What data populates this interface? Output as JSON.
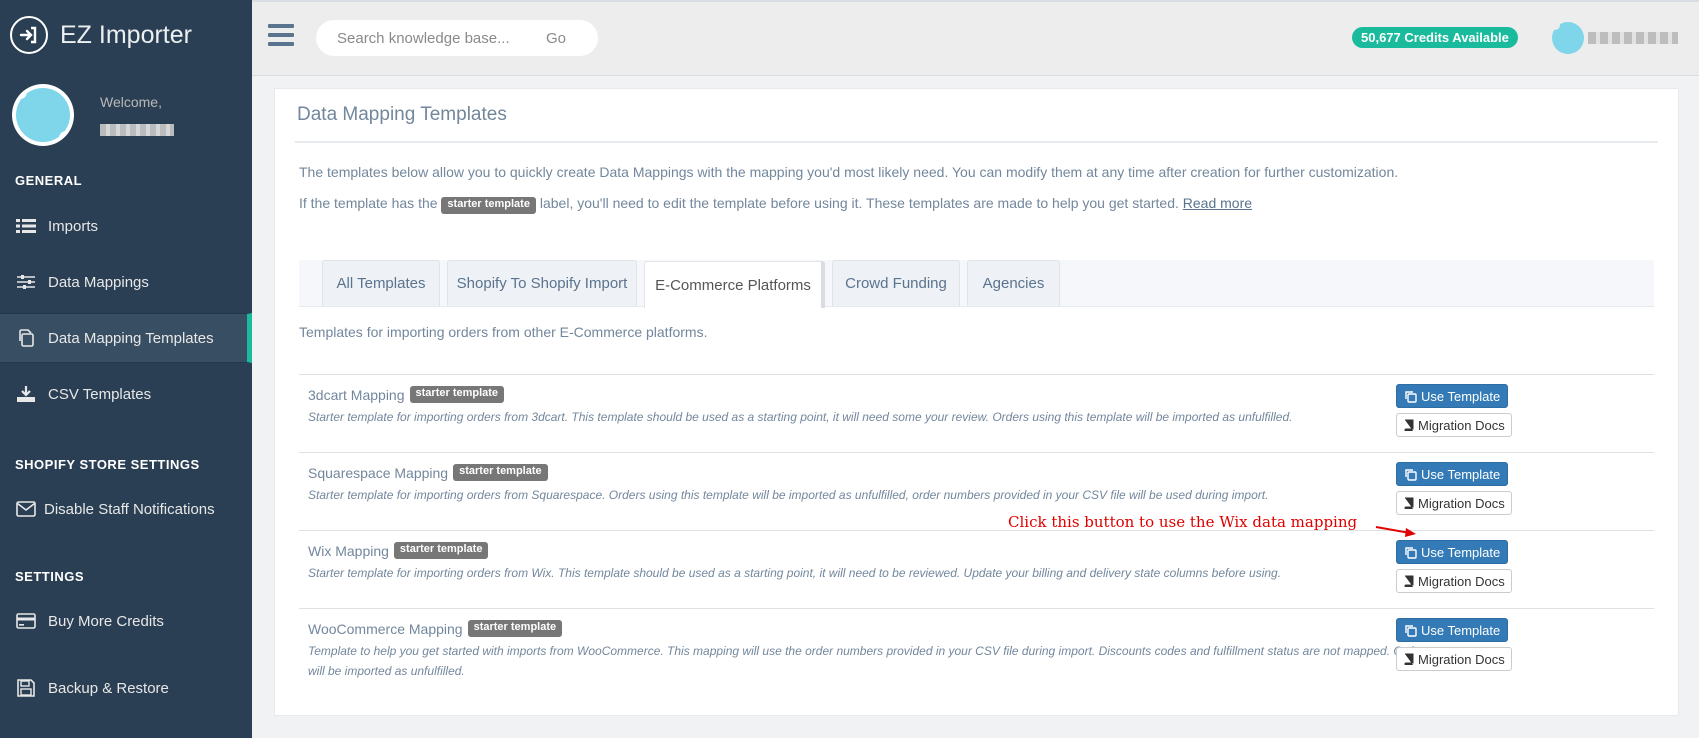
{
  "app": {
    "title": "EZ Importer"
  },
  "profile": {
    "welcome_label": "Welcome,"
  },
  "sidebar": {
    "sections": [
      {
        "label": "GENERAL"
      },
      {
        "label": "SHOPIFY STORE SETTINGS"
      },
      {
        "label": "SETTINGS"
      }
    ],
    "items": [
      {
        "label": "Imports",
        "icon": "list-icon"
      },
      {
        "label": "Data Mappings",
        "icon": "sliders-icon"
      },
      {
        "label": "Data Mapping Templates",
        "icon": "copy-icon",
        "active": true
      },
      {
        "label": "CSV Templates",
        "icon": "download-icon"
      },
      {
        "label": "Disable Staff Notifications",
        "icon": "envelope-icon"
      },
      {
        "label": "Buy More Credits",
        "icon": "credit-card-icon"
      },
      {
        "label": "Backup & Restore",
        "icon": "floppy-icon"
      }
    ]
  },
  "topnav": {
    "search_placeholder": "Search knowledge base...",
    "search_button": "Go",
    "credits": "50,677 Credits Available"
  },
  "panel": {
    "title": "Data Mapping Templates",
    "intro_1": "The templates below allow you to quickly create Data Mappings with the mapping you'd most likely need. You can modify them at any time after creation for further customization.",
    "intro_2_before": "If the template has the",
    "intro_2_badge": "starter template",
    "intro_2_after": "label, you'll need to edit the template before using it. These templates are made to help you get started.",
    "read_more": "Read more"
  },
  "tabs": [
    {
      "label": "All Templates"
    },
    {
      "label": "Shopify To Shopify Import"
    },
    {
      "label": "E-Commerce Platforms",
      "active": true
    },
    {
      "label": "Crowd Funding"
    },
    {
      "label": "Agencies"
    }
  ],
  "tab_description": "Templates for importing orders from other E-Commerce platforms.",
  "templates": [
    {
      "name": "3dcart Mapping",
      "badge": "starter template",
      "description": "Starter template for importing orders from 3dcart. This template should be used as a starting point, it will need some your review. Orders using this template will be imported as unfulfilled.",
      "use_label": "Use Template",
      "docs_label": "Migration Docs"
    },
    {
      "name": "Squarespace Mapping",
      "badge": "starter template",
      "description": "Starter template for importing orders from Squarespace. Orders using this template will be imported as unfulfilled, order numbers provided in your CSV file will be used during import.",
      "use_label": "Use Template",
      "docs_label": "Migration Docs"
    },
    {
      "name": "Wix Mapping",
      "badge": "starter template",
      "description": "Starter template for importing orders from Wix. This template should be used as a starting point, it will need to be reviewed. Update your billing and delivery state columns before using.",
      "use_label": "Use Template",
      "docs_label": "Migration Docs"
    },
    {
      "name": "WooCommerce Mapping",
      "badge": "starter template",
      "description": "Template to help you get started with imports from WooCommerce. This mapping will use the order numbers provided in your CSV file during import. Discounts codes and fulfillment status are not mapped. Order will be imported as unfulfilled.",
      "use_label": "Use Template",
      "docs_label": "Migration Docs"
    }
  ],
  "annotation": {
    "text": "Click this button to use the Wix data mapping",
    "color": "#e00000"
  },
  "colors": {
    "sidebar_bg": "#2a3f54",
    "accent": "#1abb9c",
    "primary_button": "#337ab7"
  }
}
